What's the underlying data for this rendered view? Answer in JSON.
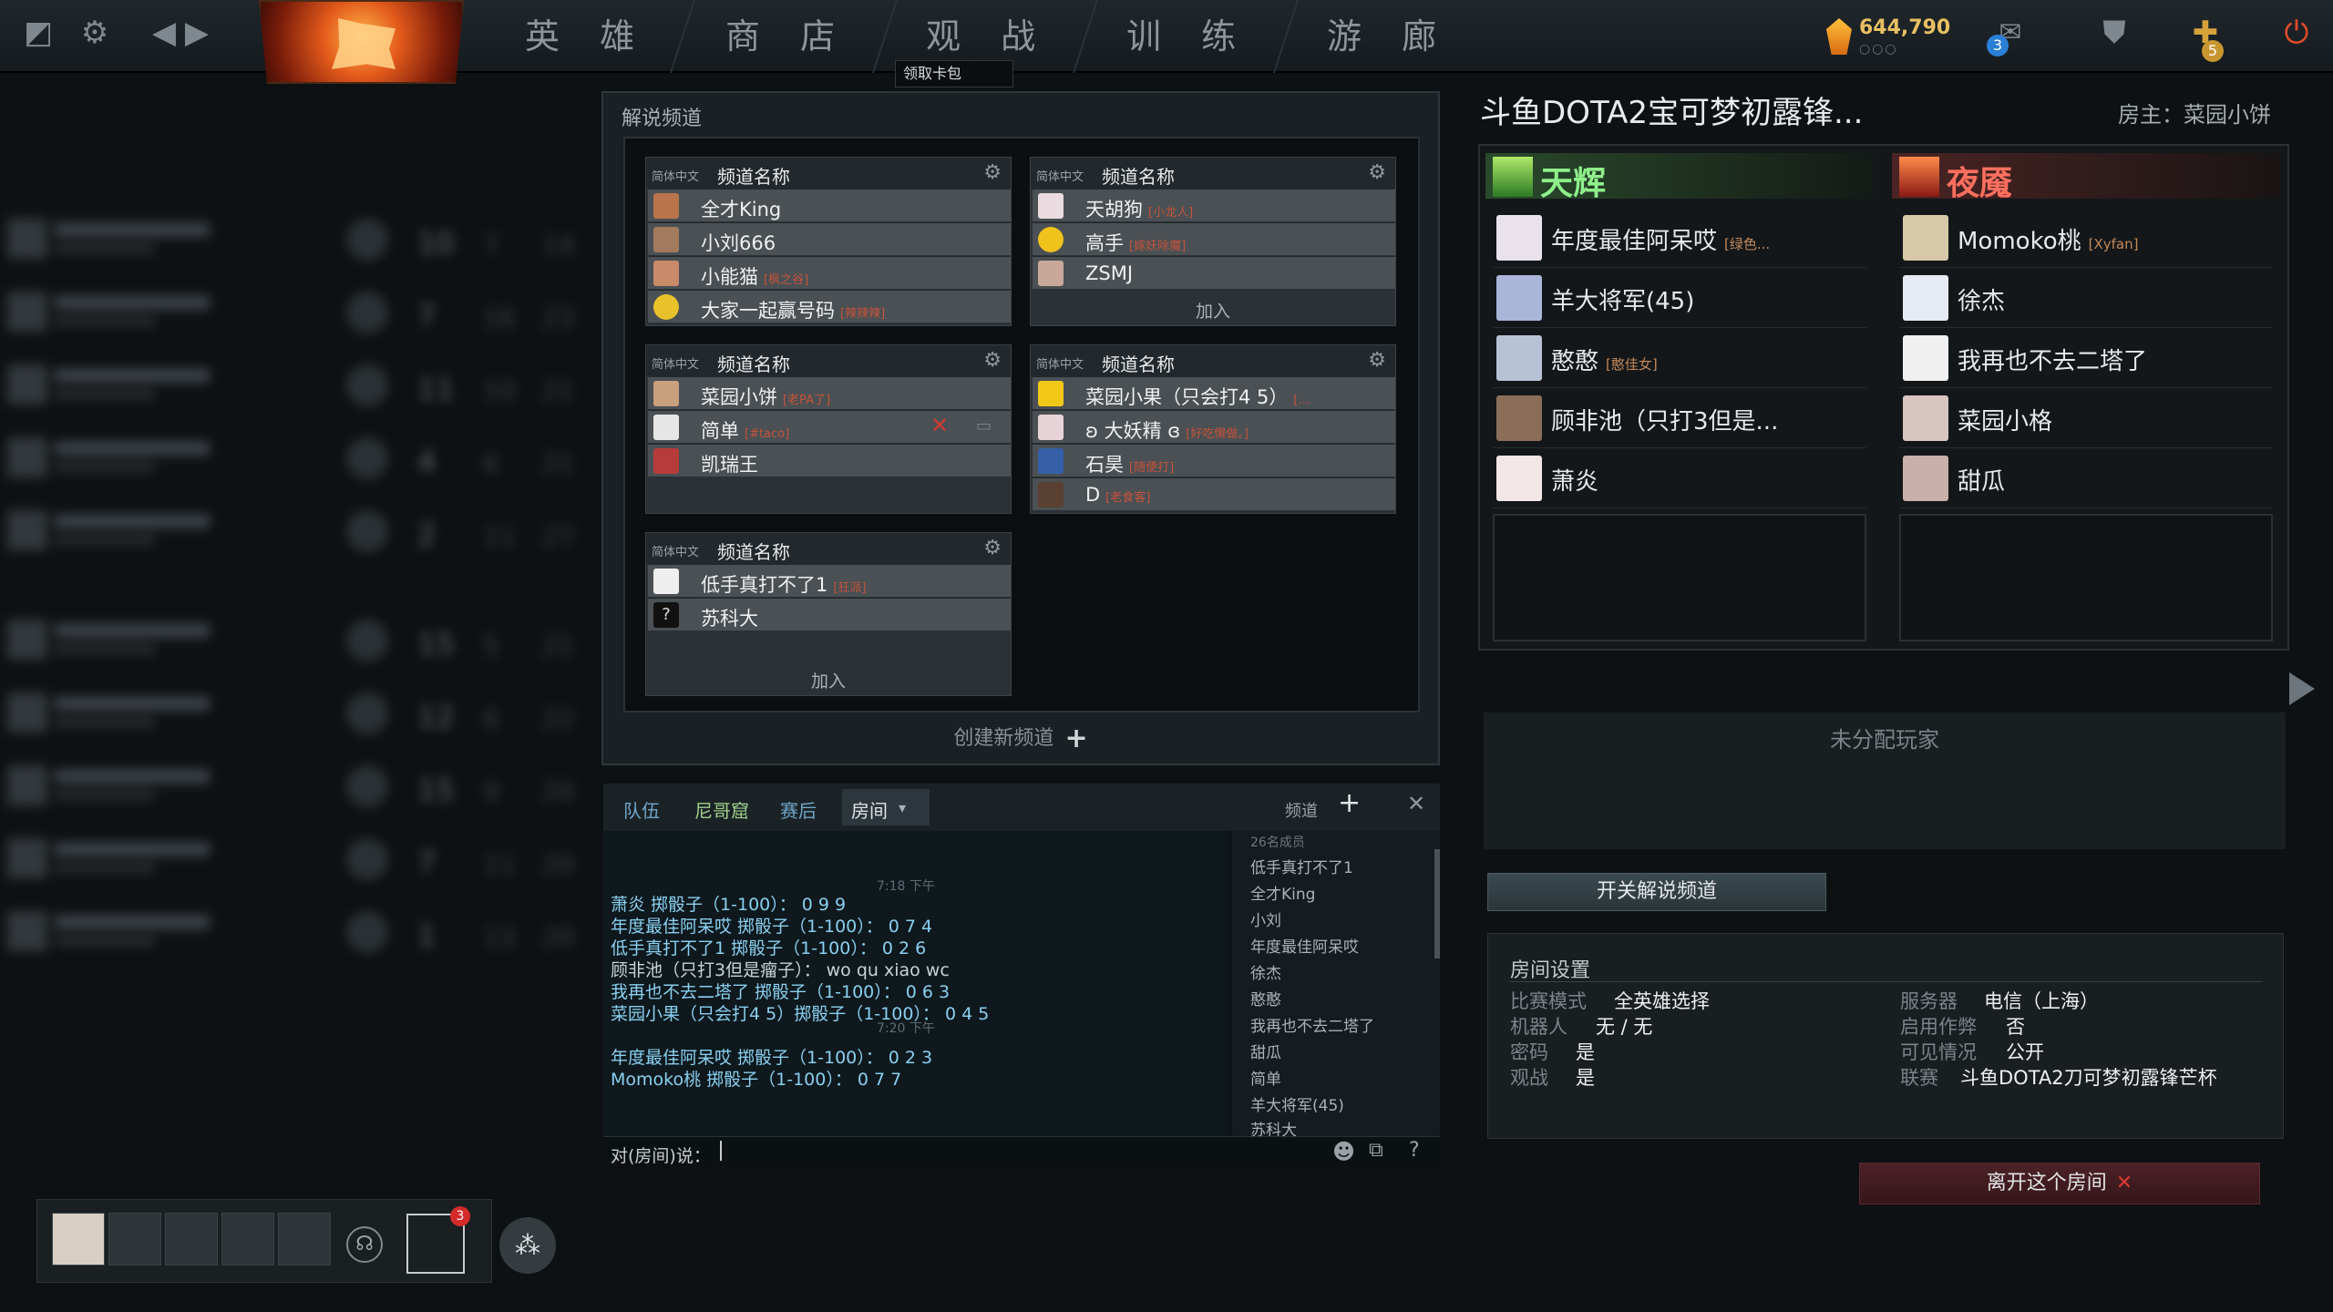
{
  "nav": {
    "heroes": "英 雄",
    "store": "商 店",
    "watch": "观 战",
    "learn": "训 练",
    "arcade": "游 廊"
  },
  "topbar": {
    "gold": "644,790",
    "gold_dots": "○○○",
    "mail_count": "3",
    "plus_count": "5",
    "tooltip": "领取卡包"
  },
  "caster_panel": {
    "title": "解说频道",
    "join_label": "加入",
    "create_label": "创建新频道",
    "channels": [
      {
        "lang": "简体中文",
        "name": "频道名称",
        "members": [
          {
            "name": "全才King",
            "tag": ""
          },
          {
            "name": "小刘666",
            "tag": ""
          },
          {
            "name": "小能猫",
            "tag": "[枫之谷]"
          },
          {
            "name": "大家一起赢号码",
            "tag": "[辣辣辣]"
          }
        ]
      },
      {
        "lang": "简体中文",
        "name": "频道名称",
        "members": [
          {
            "name": "天胡狗",
            "tag": "[小龙人]"
          },
          {
            "name": "高手",
            "tag": "[嫁妖除魔]"
          },
          {
            "name": "ZSMJ",
            "tag": ""
          }
        ]
      },
      {
        "lang": "简体中文",
        "name": "频道名称",
        "members": [
          {
            "name": "菜园小饼",
            "tag": "[老PA了]"
          },
          {
            "name": "简单",
            "tag": "[#taco]"
          },
          {
            "name": "凯瑞王",
            "tag": ""
          }
        ]
      },
      {
        "lang": "简体中文",
        "name": "频道名称",
        "members": [
          {
            "name": "菜园小果（只会打4 5）",
            "tag": "[..."
          },
          {
            "name": "ʚ 大妖精 ɞ",
            "tag": "[好吃懒做。]"
          },
          {
            "name": "石昊",
            "tag": "[随便打]"
          },
          {
            "name": "D",
            "tag": "[老食客]"
          }
        ]
      },
      {
        "lang": "简体中文",
        "name": "频道名称",
        "members": [
          {
            "name": "低手真打不了1",
            "tag": "[狂派]"
          },
          {
            "name": "苏科大",
            "tag": ""
          }
        ]
      }
    ]
  },
  "chat": {
    "tabs": [
      "队伍",
      "尼哥窟",
      "赛后",
      "房间"
    ],
    "channel_label": "频道",
    "member_count": "26名成员",
    "time1": "7:18 下午",
    "time2": "7:20 下午",
    "lines": [
      "萧炎 掷骰子（1-100）： 0 9 9",
      "年度最佳阿呆哎 掷骰子（1-100）： 0 7 4",
      "低手真打不了1 掷骰子（1-100）： 0 2 6",
      "顾非池（只打3但是瘤子）： wo qu xiao wc",
      "我再也不去二塔了 掷骰子（1-100）： 0 6 3",
      "菜园小果（只会打4 5）掷骰子（1-100）： 0 4 5",
      "年度最佳阿呆哎 掷骰子（1-100）： 0 2 3",
      "Momoko桃 掷骰子（1-100）： 0 7 7"
    ],
    "members": [
      "低手真打不了1",
      "全才King",
      "小刘",
      "年度最佳阿呆哎",
      "徐杰",
      "憨憨",
      "我再也不去二塔了",
      "甜瓜",
      "简单",
      "羊大将军(45)",
      "苏科大"
    ],
    "input_prefix": "对(房间)说："
  },
  "room": {
    "title": "斗鱼DOTA2宝可梦初露锋...",
    "host": "房主：菜园小饼",
    "radiant_label": "天辉",
    "dire_label": "夜魇",
    "radiant": [
      {
        "name": "年度最佳阿呆哎",
        "tag": "[绿色..."
      },
      {
        "name": "羊大将军(45)",
        "tag": ""
      },
      {
        "name": "憨憨",
        "tag": "[憨佳女]"
      },
      {
        "name": "顾非池（只打3但是...",
        "tag": ""
      },
      {
        "name": "萧炎",
        "tag": ""
      }
    ],
    "dire": [
      {
        "name": "Momoko桃",
        "tag": "[Xyfan]"
      },
      {
        "name": "徐杰",
        "tag": ""
      },
      {
        "name": "我再也不去二塔了",
        "tag": ""
      },
      {
        "name": "菜园小格",
        "tag": ""
      },
      {
        "name": "甜瓜",
        "tag": ""
      }
    ],
    "unassigned": "未分配玩家",
    "toggle_caster": "开关解说频道",
    "leave": "离开这个房间",
    "settings": {
      "title": "房间设置",
      "game_mode_k": "比赛模式",
      "game_mode_v": "全英雄选择",
      "bots_k": "机器人",
      "bots_v": "无 / 无",
      "password_k": "密码",
      "password_v": "是",
      "spectate_k": "观战",
      "spectate_v": "是",
      "server_k": "服务器",
      "server_v": "电信（上海）",
      "cheats_k": "启用作弊",
      "cheats_v": "否",
      "visibility_k": "可见情况",
      "visibility_v": "公开",
      "league_k": "联赛",
      "league_v": "斗鱼DOTA2刀可梦初露锋芒杯"
    }
  },
  "party": {
    "notif_count": "3"
  },
  "colors": {
    "radiant": "#7ee07e",
    "dire": "#ff6b5b",
    "chat_text": "#8ad0f0"
  }
}
